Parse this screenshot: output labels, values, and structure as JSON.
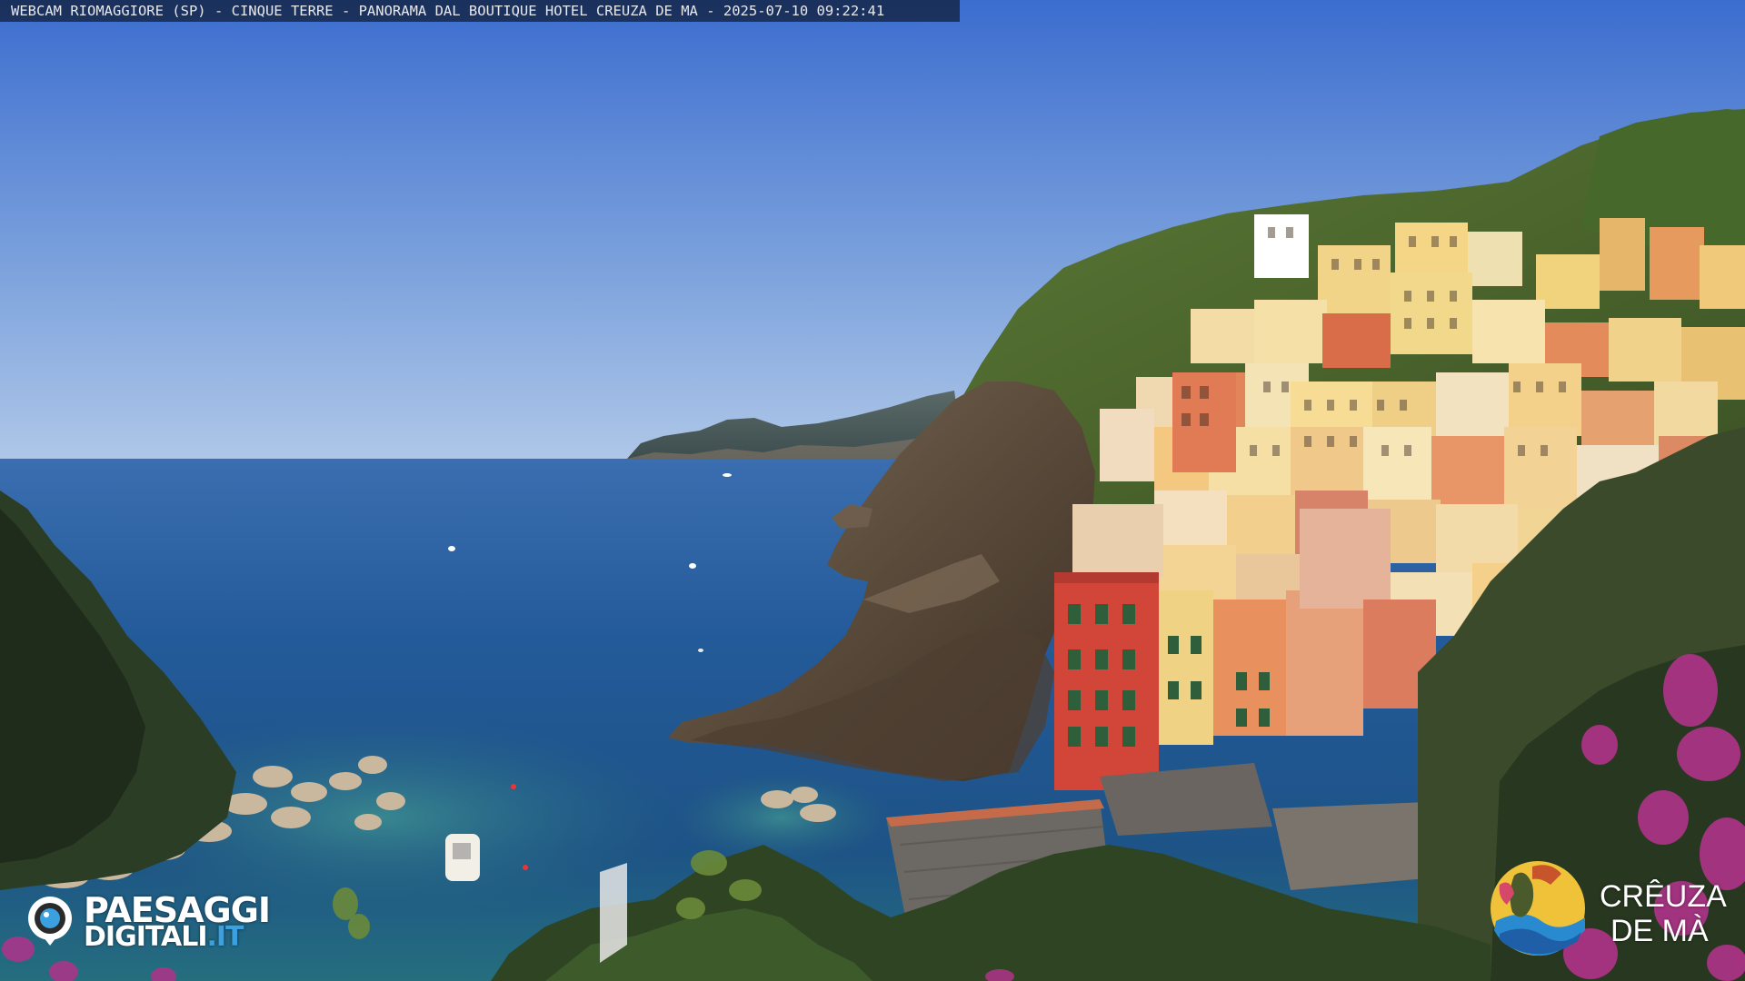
{
  "overlay": {
    "caption": "WEBCAM RIOMAGGIORE (SP) - CINQUE TERRE - PANORAMA DAL BOUTIQUE HOTEL CREUZA DE MA - 2025-07-10 09:22:41"
  },
  "logos": {
    "left": {
      "line1": "PAESAGGI",
      "line2": "DIGITALI",
      "line2_suffix": ".IT"
    },
    "right": {
      "line1": "CRÊUZA",
      "line2": "DE MÀ"
    }
  },
  "colors": {
    "sky_top": "#3d6fd0",
    "sky_horizon": "#a9c3e6",
    "sea_deep": "#1f4f8c",
    "sea_near": "#2c6c8a",
    "cliff": "#5e4e3e",
    "hillside_green": "#4d6a2c",
    "building_red": "#d24a3c",
    "building_yellow": "#e9cf7a",
    "building_orange": "#e08a55",
    "bougainvillea": "#b0338a",
    "logo_accent": "#3aa0e0"
  },
  "icons": {
    "left_logo": "camera-pin-icon",
    "right_logo": "creuza-emblem-icon"
  }
}
